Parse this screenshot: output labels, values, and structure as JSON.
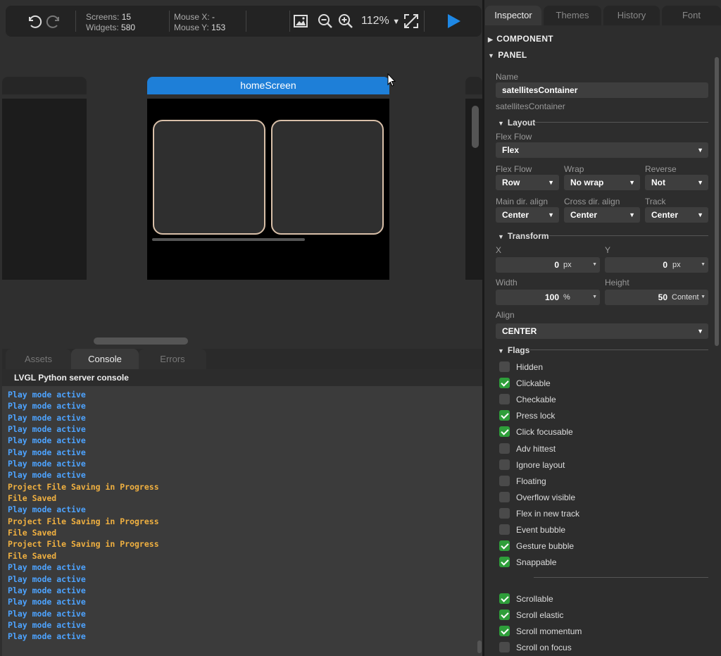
{
  "toolbar": {
    "screens_label": "Screens:",
    "screens_value": "15",
    "widgets_label": "Widgets:",
    "widgets_value": "580",
    "mouse_x_label": "Mouse X:",
    "mouse_x_value": "-",
    "mouse_y_label": "Mouse Y:",
    "mouse_y_value": "153",
    "zoom": "112%"
  },
  "canvas": {
    "screen_title": "homeScreen"
  },
  "bottom_tabs": [
    "Assets",
    "Console",
    "Errors"
  ],
  "console": {
    "title": "LVGL Python server console",
    "lines": [
      {
        "text": "Play mode active",
        "kind": "info"
      },
      {
        "text": "Play mode active",
        "kind": "info"
      },
      {
        "text": "Play mode active",
        "kind": "info"
      },
      {
        "text": "Play mode active",
        "kind": "info"
      },
      {
        "text": "Play mode active",
        "kind": "info"
      },
      {
        "text": "Play mode active",
        "kind": "info"
      },
      {
        "text": "Play mode active",
        "kind": "info"
      },
      {
        "text": "Play mode active",
        "kind": "info"
      },
      {
        "text": "Project File Saving in Progress",
        "kind": "warn"
      },
      {
        "text": "File Saved",
        "kind": "warn"
      },
      {
        "text": "Play mode active",
        "kind": "info"
      },
      {
        "text": "Project File Saving in Progress",
        "kind": "warn"
      },
      {
        "text": "File Saved",
        "kind": "warn"
      },
      {
        "text": "Project File Saving in Progress",
        "kind": "warn"
      },
      {
        "text": "File Saved",
        "kind": "warn"
      },
      {
        "text": "Play mode active",
        "kind": "info"
      },
      {
        "text": "Play mode active",
        "kind": "info"
      },
      {
        "text": "Play mode active",
        "kind": "info"
      },
      {
        "text": "Play mode active",
        "kind": "info"
      },
      {
        "text": "Play mode active",
        "kind": "info"
      },
      {
        "text": "Play mode active",
        "kind": "info"
      },
      {
        "text": "Play mode active",
        "kind": "info"
      }
    ]
  },
  "inspector": {
    "tabs": [
      "Inspector",
      "Themes",
      "History",
      "Font"
    ],
    "component_header": "COMPONENT",
    "panel_header": "PANEL",
    "name_label": "Name",
    "name_value": "satellitesContainer",
    "name_hint": "satellitesContainer",
    "layout": {
      "title": "Layout",
      "flex_flow_label": "Flex Flow",
      "flex_flow_value": "Flex",
      "flow_label": "Flex Flow",
      "flow_value": "Row",
      "wrap_label": "Wrap",
      "wrap_value": "No wrap",
      "reverse_label": "Reverse",
      "reverse_value": "Not",
      "main_align_label": "Main dir. align",
      "main_align_value": "Center",
      "cross_align_label": "Cross dir. align",
      "cross_align_value": "Center",
      "track_label": "Track",
      "track_value": "Center"
    },
    "transform": {
      "title": "Transform",
      "x_label": "X",
      "x_value": "0",
      "x_unit": "px",
      "y_label": "Y",
      "y_value": "0",
      "y_unit": "px",
      "width_label": "Width",
      "width_value": "100",
      "width_unit": "%",
      "height_label": "Height",
      "height_value": "50",
      "height_unit": "Content",
      "align_label": "Align",
      "align_value": "CENTER"
    },
    "flags_title": "Flags",
    "flags": [
      {
        "label": "Hidden",
        "checked": false
      },
      {
        "label": "Clickable",
        "checked": true
      },
      {
        "label": "Checkable",
        "checked": false
      },
      {
        "label": "Press lock",
        "checked": true
      },
      {
        "label": "Click focusable",
        "checked": true
      },
      {
        "label": "Adv hittest",
        "checked": false
      },
      {
        "label": "Ignore layout",
        "checked": false
      },
      {
        "label": "Floating",
        "checked": false
      },
      {
        "label": "Overflow visible",
        "checked": false
      },
      {
        "label": "Flex in new track",
        "checked": false
      },
      {
        "label": "Event bubble",
        "checked": false
      },
      {
        "label": "Gesture bubble",
        "checked": true
      },
      {
        "label": "Snappable",
        "checked": true
      }
    ],
    "scroll_flags": [
      {
        "label": "Scrollable",
        "checked": true
      },
      {
        "label": "Scroll elastic",
        "checked": true
      },
      {
        "label": "Scroll momentum",
        "checked": true
      },
      {
        "label": "Scroll on focus",
        "checked": false
      }
    ]
  },
  "colors": {
    "accent": "#1e7fd8",
    "play": "#1e88e5",
    "console_info": "#4da3ff",
    "console_warn": "#f0b040",
    "check_on": "#2e9e3a",
    "satellite_border": "#d8bfa8"
  },
  "icons": [
    "undo-icon",
    "redo-icon",
    "image-icon",
    "zoom-out-icon",
    "zoom-in-icon",
    "chevron-down-icon",
    "fit-screen-icon",
    "play-icon",
    "mouse-cursor-icon"
  ]
}
